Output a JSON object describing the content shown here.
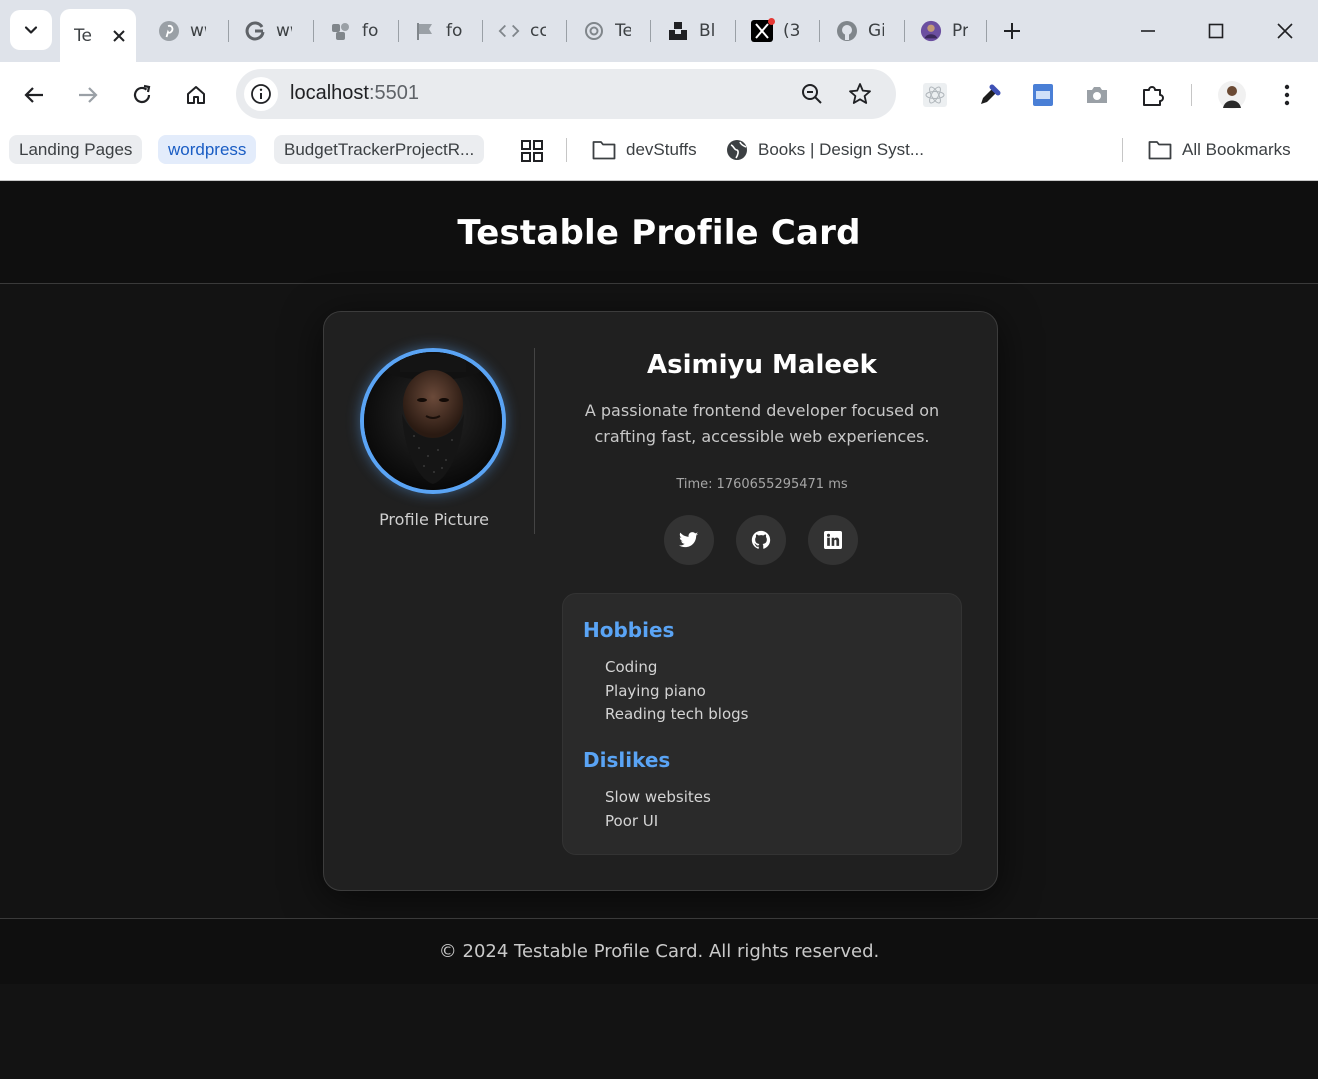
{
  "browser": {
    "tabs": [
      {
        "title": "Testable Profile Card",
        "short": "Te",
        "icon": "page-icon",
        "active": true
      },
      {
        "title": "ww",
        "short": "ww",
        "icon": "pinterest-icon"
      },
      {
        "title": "ww",
        "short": "ww",
        "icon": "google-icon"
      },
      {
        "title": "fo",
        "short": "fo",
        "icon": "figma-community-icon"
      },
      {
        "title": "fo",
        "short": "fo",
        "icon": "flag-icon"
      },
      {
        "title": "cc",
        "short": "cc",
        "icon": "code-icon"
      },
      {
        "title": "Te",
        "short": "Te",
        "icon": "chatgpt-icon"
      },
      {
        "title": "Bl",
        "short": "Bl",
        "icon": "unsplash-icon"
      },
      {
        "title": "(3",
        "short": "(3",
        "icon": "x-icon"
      },
      {
        "title": "Gi",
        "short": "Gi",
        "icon": "github-icon"
      },
      {
        "title": "Pr",
        "short": "Pr",
        "icon": "profile-icon"
      }
    ],
    "url_host": "localhost",
    "url_port": ":5501",
    "bookmarks": [
      {
        "label": "Landing Pages"
      },
      {
        "label": "wordpress"
      },
      {
        "label": "BudgetTrackerProjectR..."
      },
      {
        "label": "devStuffs"
      },
      {
        "label": "Books | Design Syst..."
      },
      {
        "label": "All Bookmarks"
      }
    ]
  },
  "page": {
    "header_title": "Testable Profile Card",
    "profile": {
      "name": "Asimiyu Maleek",
      "bio": "A passionate frontend developer focused on crafting fast, accessible web experiences.",
      "avatar_caption": "Profile Picture",
      "time_label": "Time:",
      "time_value": "1760655295471 ms",
      "socials": [
        {
          "name": "Twitter",
          "icon": "twitter-icon"
        },
        {
          "name": "GitHub",
          "icon": "github-icon"
        },
        {
          "name": "LinkedIn",
          "icon": "linkedin-icon"
        }
      ],
      "hobbies_title": "Hobbies",
      "hobbies": [
        "Coding",
        "Playing piano",
        "Reading tech blogs"
      ],
      "dislikes_title": "Dislikes",
      "dislikes": [
        "Slow websites",
        "Poor UI"
      ]
    },
    "footer": "© 2024 Testable Profile Card. All rights reserved."
  },
  "colors": {
    "accent": "#5aa4f5",
    "page_bg": "#131313",
    "card_bg": "#202020"
  }
}
